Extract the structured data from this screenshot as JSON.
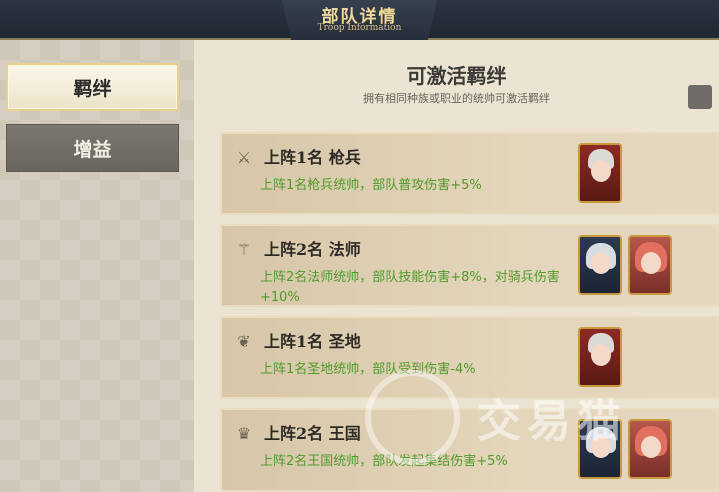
{
  "header": {
    "title": "部队详情",
    "subtitle": "Troop Information"
  },
  "sidebar": {
    "tabs": [
      {
        "label": "羁绊",
        "active": true
      },
      {
        "label": "增益",
        "active": false
      }
    ]
  },
  "main": {
    "heading": "可激活羁绊",
    "description": "拥有相同种族或职业的统帅可激活羁绊",
    "bonds": [
      {
        "icon": "spear-icon",
        "title": "上阵1名 枪兵",
        "desc": "上阵1名枪兵统帅，部队普攻伤害+5%",
        "portraits": [
          "knight"
        ]
      },
      {
        "icon": "staff-icon",
        "title": "上阵2名 法师",
        "desc": "上阵2名法师统帅，部队技能伤害+8%，对骑兵伤害+10%",
        "portraits": [
          "silver",
          "red"
        ]
      },
      {
        "icon": "wings-icon",
        "title": "上阵1名 圣地",
        "desc": "上阵1名圣地统帅，部队受到伤害-4%",
        "portraits": [
          "knight"
        ]
      },
      {
        "icon": "crown-icon",
        "title": "上阵2名 王国",
        "desc": "上阵2名王国统帅，部队发起集结伤害+5%",
        "portraits": [
          "silver",
          "red"
        ]
      }
    ]
  },
  "watermark": {
    "text": "交易猫"
  },
  "colors": {
    "header_bg": "#1f2731",
    "title_gold": "#f2d89b",
    "bonus_green": "#4f9a2a"
  }
}
